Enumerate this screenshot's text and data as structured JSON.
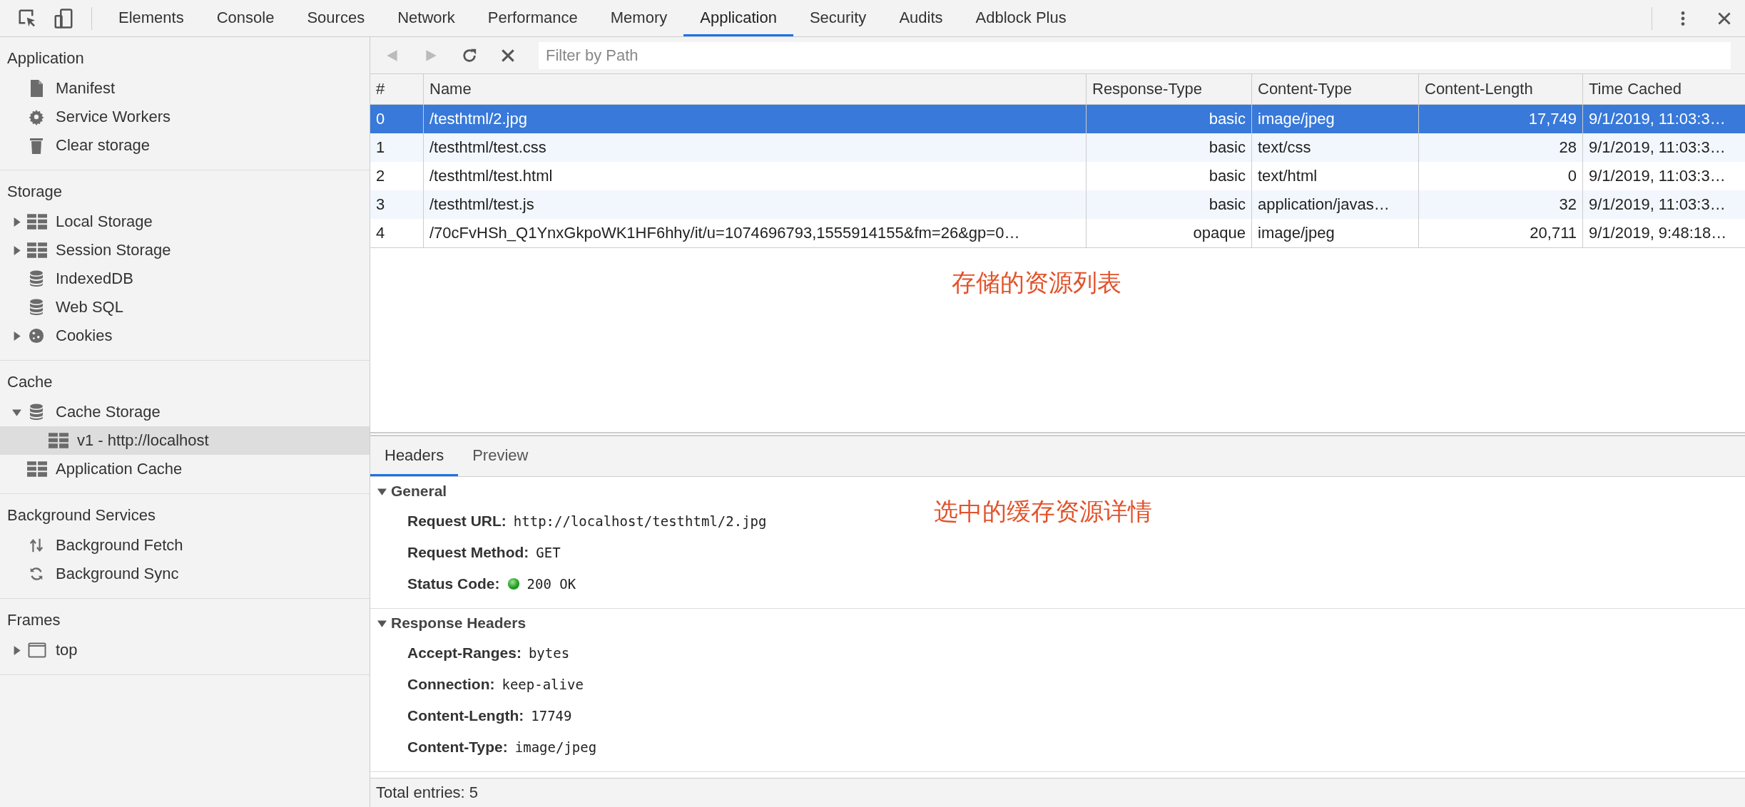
{
  "toolbar": {
    "tabs": [
      {
        "label": "Elements",
        "selected": false
      },
      {
        "label": "Console",
        "selected": false
      },
      {
        "label": "Sources",
        "selected": false
      },
      {
        "label": "Network",
        "selected": false
      },
      {
        "label": "Performance",
        "selected": false
      },
      {
        "label": "Memory",
        "selected": false
      },
      {
        "label": "Application",
        "selected": true
      },
      {
        "label": "Security",
        "selected": false
      },
      {
        "label": "Audits",
        "selected": false
      },
      {
        "label": "Adblock Plus",
        "selected": false
      }
    ]
  },
  "sidebar": {
    "sections": [
      {
        "title": "Application",
        "items": [
          {
            "label": "Manifest",
            "selected": false
          },
          {
            "label": "Service Workers",
            "selected": false
          },
          {
            "label": "Clear storage",
            "selected": false
          }
        ]
      },
      {
        "title": "Storage",
        "items": [
          {
            "label": "Local Storage",
            "selected": false,
            "expanded": false
          },
          {
            "label": "Session Storage",
            "selected": false,
            "expanded": false
          },
          {
            "label": "IndexedDB",
            "selected": false
          },
          {
            "label": "Web SQL",
            "selected": false
          },
          {
            "label": "Cookies",
            "selected": false,
            "expanded": false
          }
        ]
      },
      {
        "title": "Cache",
        "items": [
          {
            "label": "Cache Storage",
            "selected": false,
            "expanded": true,
            "children": [
              {
                "label": "v1 - http://localhost",
                "selected": true
              }
            ]
          },
          {
            "label": "Application Cache",
            "selected": false
          }
        ]
      },
      {
        "title": "Background Services",
        "items": [
          {
            "label": "Background Fetch",
            "selected": false
          },
          {
            "label": "Background Sync",
            "selected": false
          }
        ]
      },
      {
        "title": "Frames",
        "items": [
          {
            "label": "top",
            "selected": false,
            "expanded": false
          }
        ]
      }
    ]
  },
  "cache_toolbar": {
    "back_disabled": true,
    "forward_disabled": true,
    "filter": {
      "placeholder": "Filter by Path"
    }
  },
  "table": {
    "columns": [
      "#",
      "Name",
      "Response-Type",
      "Content-Type",
      "Content-Length",
      "Time Cached"
    ],
    "rows": [
      {
        "cells": [
          "0",
          "/testhtml/2.jpg",
          "basic",
          "image/jpeg",
          "17,749",
          "9/1/2019, 11:03:3…"
        ],
        "selected": true
      },
      {
        "cells": [
          "1",
          "/testhtml/test.css",
          "basic",
          "text/css",
          "28",
          "9/1/2019, 11:03:3…"
        ],
        "selected": false
      },
      {
        "cells": [
          "2",
          "/testhtml/test.html",
          "basic",
          "text/html",
          "0",
          "9/1/2019, 11:03:3…"
        ],
        "selected": false
      },
      {
        "cells": [
          "3",
          "/testhtml/test.js",
          "basic",
          "application/javas…",
          "32",
          "9/1/2019, 11:03:3…"
        ],
        "selected": false
      },
      {
        "cells": [
          "4",
          "/70cFvHSh_Q1YnxGkpoWK1HF6hhy/it/u=1074696793,1555914155&fm=26&gp=0…",
          "opaque",
          "image/jpeg",
          "20,711",
          "9/1/2019, 9:48:18…"
        ],
        "selected": false
      }
    ]
  },
  "table_annotation": "存储的资源列表",
  "detail": {
    "tabs": [
      {
        "label": "Headers",
        "selected": true
      },
      {
        "label": "Preview",
        "selected": false
      }
    ],
    "annotation": "选中的缓存资源详情",
    "sections": [
      {
        "title": "General",
        "expanded": true,
        "entries": [
          {
            "name": "Request URL:",
            "value": "http://localhost/testhtml/2.jpg"
          },
          {
            "name": "Request Method:",
            "value": "GET"
          },
          {
            "name": "Status Code:",
            "value": "200 OK",
            "kind": "status"
          }
        ]
      },
      {
        "title": "Response Headers",
        "expanded": true,
        "entries": [
          {
            "name": "Accept-Ranges:",
            "value": "bytes"
          },
          {
            "name": "Connection:",
            "value": "keep-alive"
          },
          {
            "name": "Content-Length:",
            "value": "17749"
          },
          {
            "name": "Content-Type:",
            "value": "image/jpeg"
          }
        ]
      }
    ]
  },
  "status_bar": "Total entries: 5"
}
